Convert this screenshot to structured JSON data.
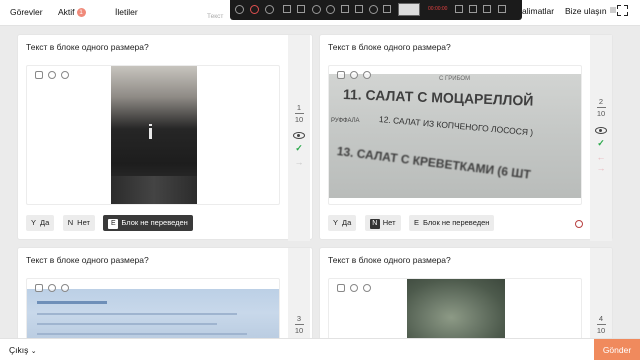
{
  "header": {
    "nav": [
      {
        "label": "Görevler"
      },
      {
        "label": "Aktif",
        "badge": "1"
      },
      {
        "label": "İletiler"
      }
    ],
    "ghost_text": "Текст",
    "right_items": [
      "alimatlar",
      "Bize ulaşın"
    ],
    "recorder_status": "00:00:00"
  },
  "cards": [
    {
      "title": "Текст в блоке одного размера?",
      "page": "1",
      "total": "10",
      "answers": [
        {
          "key": "Y",
          "label": "Да"
        },
        {
          "key": "N",
          "label": "Нет"
        },
        {
          "key": "E",
          "label": "Блок не переведен",
          "selected": true
        }
      ]
    },
    {
      "title": "Текст в блоке одного размера?",
      "page": "2",
      "total": "10",
      "image_text": {
        "line0": "С ГРИБОМ",
        "line1": "11.  САЛАТ С МОЦАРЕЛЛОЙ",
        "prefix": "РУФФАЛА",
        "line2": "12. САЛАТ ИЗ КОПЧЕНОГО ЛОСОСЯ )",
        "line3": "13.  САЛАТ С КРЕВЕТКАМИ (6 ШТ"
      },
      "answers": [
        {
          "key": "Y",
          "label": "Да"
        },
        {
          "key": "N",
          "label": "Нет",
          "selected": true
        },
        {
          "key": "E",
          "label": "Блок не переведен"
        }
      ]
    },
    {
      "title": "Текст в блоке одного размера?",
      "page": "3",
      "total": "10"
    },
    {
      "title": "Текст в блоке одного размера?",
      "page": "4",
      "total": "10"
    }
  ],
  "footer": {
    "exit_label": "Çıkış",
    "send_label": "Gönder"
  },
  "colors": {
    "accent": "#f08a5d",
    "badge": "#f08a7a",
    "check": "#2aa84a"
  }
}
